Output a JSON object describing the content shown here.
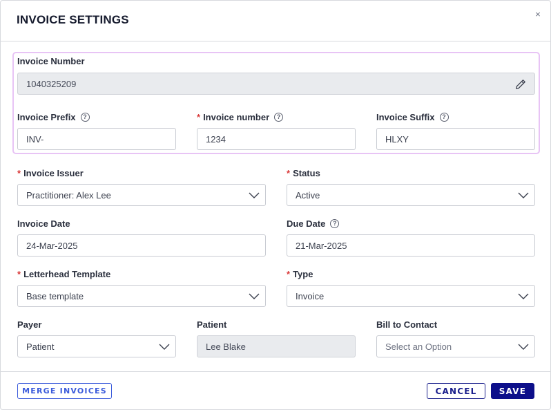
{
  "dialog": {
    "title": "INVOICE SETTINGS",
    "close_symbol": "×"
  },
  "invoice_number_group": {
    "label": "Invoice Number",
    "value": "1040325209",
    "prefix": {
      "label": "Invoice Prefix",
      "value": "INV-",
      "help": "?"
    },
    "number": {
      "label": "Invoice number",
      "value": "1234",
      "required": "*",
      "help": "?"
    },
    "suffix": {
      "label": "Invoice Suffix",
      "value": "HLXY",
      "help": "?"
    }
  },
  "form": {
    "issuer": {
      "label": "Invoice Issuer",
      "required": "*",
      "value": "Practitioner: Alex Lee"
    },
    "status": {
      "label": "Status",
      "required": "*",
      "value": "Active"
    },
    "invoice_date": {
      "label": "Invoice Date",
      "value": "24-Mar-2025"
    },
    "due_date": {
      "label": "Due Date",
      "value": "21-Mar-2025",
      "help": "?"
    },
    "letterhead": {
      "label": "Letterhead Template",
      "required": "*",
      "value": "Base template"
    },
    "type": {
      "label": "Type",
      "required": "*",
      "value": "Invoice"
    },
    "payer": {
      "label": "Payer",
      "value": "Patient"
    },
    "patient": {
      "label": "Patient",
      "value": "Lee Blake"
    },
    "bill_to": {
      "label": "Bill to Contact",
      "placeholder": "Select an Option"
    }
  },
  "footer": {
    "merge_label": "MERGE INVOICES",
    "cancel_label": "CANCEL",
    "save_label": "SAVE"
  },
  "icons": {
    "close": "close-icon",
    "edit": "pencil-icon",
    "help": "question-circle-icon",
    "dropdown": "chevron-down-icon"
  },
  "colors": {
    "highlight_border": "#e8c4f5",
    "required": "#d93a3a",
    "primary": "#0d0f8a",
    "merge_outline": "#3b5bdb",
    "disabled_field": "#e9ebee"
  }
}
